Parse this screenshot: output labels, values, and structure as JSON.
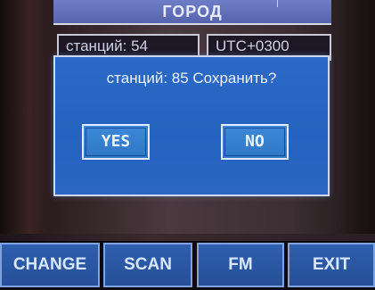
{
  "header": {
    "title": "ГОРОД"
  },
  "info": {
    "stations_text": "станций: 54",
    "timezone_text": "UTC+0300"
  },
  "dialog": {
    "message": "станций: 85 Сохранить?",
    "yes_label": "YES",
    "no_label": "NO"
  },
  "softkeys": {
    "change": "CHANGE",
    "scan": "SCAN",
    "fm": "FM",
    "exit": "EXIT"
  },
  "colors": {
    "title_bar": "#5f6fb8",
    "dialog_bg": "#2865c2",
    "softkey_bg": "#2a56a2",
    "background": "#3a2c30"
  }
}
